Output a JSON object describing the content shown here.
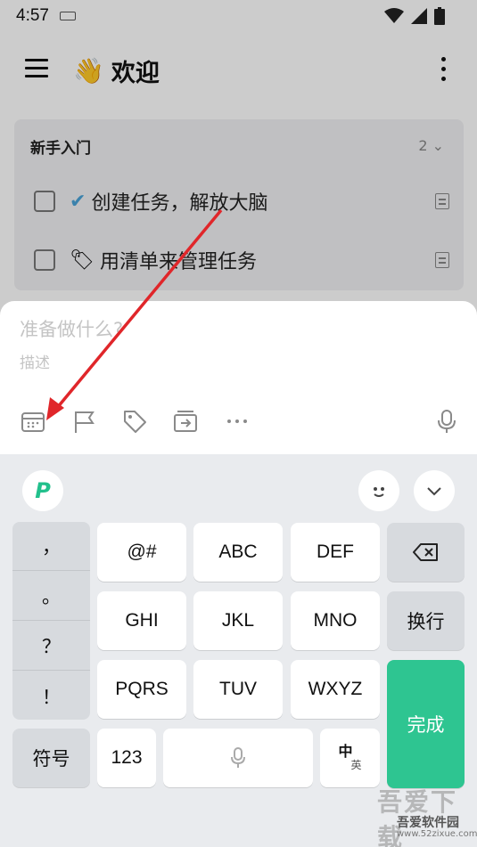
{
  "status": {
    "time": "4:57"
  },
  "header": {
    "title_emoji": "👋",
    "title": "欢迎"
  },
  "section": {
    "title": "新手入门",
    "count": "2",
    "tasks": [
      {
        "emoji": "✔",
        "label": "创建任务，解放大脑"
      },
      {
        "emoji": "🏷",
        "label": "用清单来管理任务"
      }
    ]
  },
  "composer": {
    "title_placeholder": "准备做什么?",
    "desc_placeholder": "描述"
  },
  "keyboard": {
    "punct": [
      "，",
      "。",
      "？",
      "！"
    ],
    "row1": [
      "@#",
      "ABC",
      "DEF"
    ],
    "row2": [
      "GHI",
      "JKL",
      "MNO"
    ],
    "row3": [
      "PQRS",
      "TUV",
      "WXYZ"
    ],
    "newline": "换行",
    "done": "完成",
    "symbols": "符号",
    "num": "123",
    "lang_main": "中",
    "lang_sub": "英"
  },
  "watermark": {
    "big": "吾爱下载",
    "site": "吾爱软件园",
    "url": "www.52zixue.com"
  },
  "colors": {
    "accent": "#2ec591",
    "arrow": "#e0262a"
  }
}
